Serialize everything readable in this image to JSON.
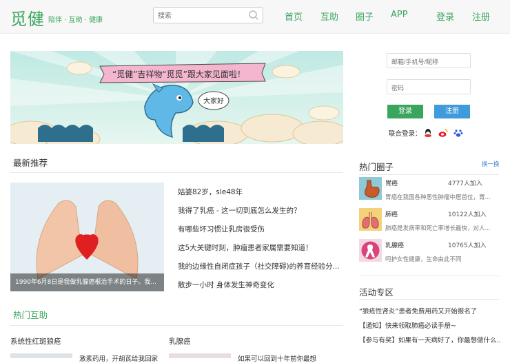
{
  "header": {
    "logo": "觅健",
    "slogan": "陪伴 · 互助 · 健康",
    "search_placeholder": "搜索",
    "nav": [
      "首页",
      "互助",
      "圈子",
      "APP",
      "登录",
      "注册"
    ]
  },
  "banner": {
    "ribbon_text": "“觅健”吉祥物“觅觅”跟大家见面啦！",
    "bubble_text": "大家好"
  },
  "login": {
    "account_placeholder": "邮箱/手机号/昵称",
    "password_placeholder": "密码",
    "login_label": "登录",
    "register_label": "注册",
    "union_label": "联合登录："
  },
  "latest": {
    "title": "最新推荐",
    "photo_caption": "1990年6月8日是我做乳腺癌根治手术的日子。我...",
    "items": [
      "姑婆82岁，sle48年",
      "我得了乳癌 - 这一切到底怎么发生的？",
      "有哪些坏习惯让乳房很受伤",
      "这5大关键时刻，肿瘤患者家属需要知道！",
      "我的边缘性自闭症孩子（社交障碍)的养育经验分...",
      "散步一小时 身体发生神奇变化"
    ]
  },
  "hot_help": {
    "title": "热门互助",
    "col1": "系统性红斑狼疮",
    "col2": "乳腺癌",
    "snippet1": "激素药用，开胡芪给我回家",
    "snippet2": "如果可以回到十年前你最想"
  },
  "hot_groups": {
    "title": "热门圈子",
    "switch_label": "换一换",
    "groups": [
      {
        "name": "胃癌",
        "count": "4777人加入",
        "desc": "胃癌在我国各种恶性肿瘤中居首位，胃..."
      },
      {
        "name": "肺癌",
        "count": "10122人加入",
        "desc": "肺癌是发病率和死亡率增长最快，对人..."
      },
      {
        "name": "乳腺癌",
        "count": "10765人加入",
        "desc": "呵护女性健康，生命由此不同"
      }
    ]
  },
  "activities": {
    "title": "活动专区",
    "items": [
      "“狼疮性肾炎”患者免费用药又开始报名了",
      "【通知】快来领取肺癌必读手册~",
      "【参与有奖】如果有一天病好了，你最想做什么..."
    ]
  },
  "colors": {
    "brand": "#3aa55c",
    "login_button": "#3aa55c",
    "register_button": "#3f9bdb"
  }
}
